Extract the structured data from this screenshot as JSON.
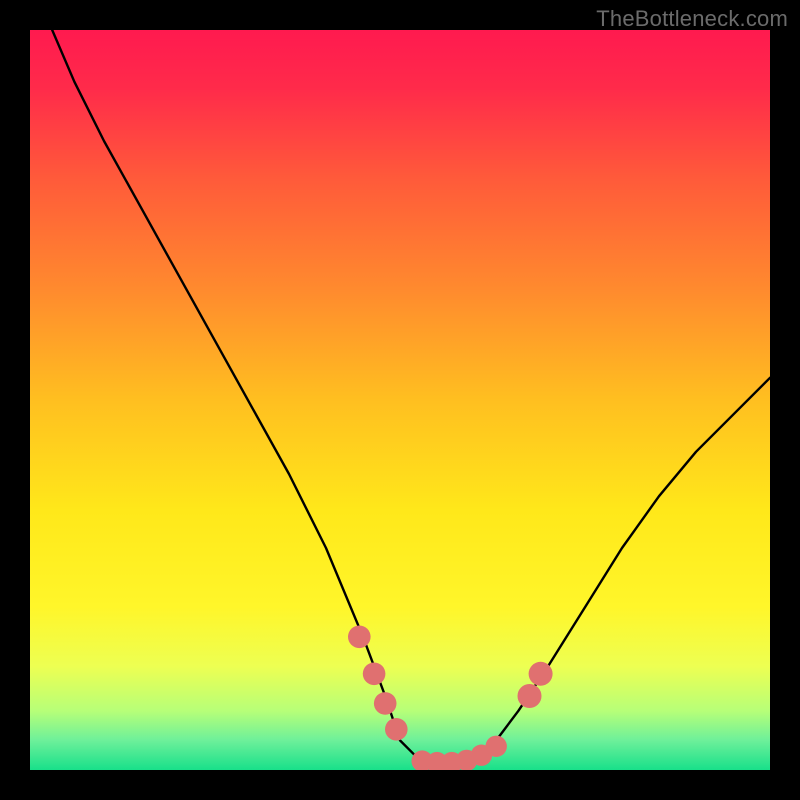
{
  "watermark": "TheBottleneck.com",
  "colors": {
    "background": "#000000",
    "gradient_stops": [
      {
        "offset": 0.0,
        "color": "#ff1a4f"
      },
      {
        "offset": 0.08,
        "color": "#ff2b4a"
      },
      {
        "offset": 0.2,
        "color": "#ff5a3a"
      },
      {
        "offset": 0.35,
        "color": "#ff8a2e"
      },
      {
        "offset": 0.5,
        "color": "#ffbf20"
      },
      {
        "offset": 0.65,
        "color": "#ffe81a"
      },
      {
        "offset": 0.78,
        "color": "#fff62a"
      },
      {
        "offset": 0.86,
        "color": "#edff52"
      },
      {
        "offset": 0.92,
        "color": "#b7ff78"
      },
      {
        "offset": 0.96,
        "color": "#6df09a"
      },
      {
        "offset": 1.0,
        "color": "#18e08a"
      }
    ],
    "curve": "#000000",
    "markers": "#e07070"
  },
  "chart_data": {
    "type": "line",
    "title": "",
    "xlabel": "",
    "ylabel": "",
    "xlim": [
      0,
      100
    ],
    "ylim": [
      0,
      100
    ],
    "grid": false,
    "series": [
      {
        "name": "curve",
        "x": [
          3,
          6,
          10,
          15,
          20,
          25,
          30,
          35,
          40,
          45,
          48,
          50,
          52,
          55,
          58,
          60,
          63,
          66,
          70,
          75,
          80,
          85,
          90,
          95,
          100
        ],
        "y": [
          100,
          93,
          85,
          76,
          67,
          58,
          49,
          40,
          30,
          18,
          10,
          4,
          2,
          1,
          1,
          2,
          4,
          8,
          14,
          22,
          30,
          37,
          43,
          48,
          53
        ]
      }
    ],
    "markers": [
      {
        "x": 44.5,
        "y": 18,
        "r": 1.1
      },
      {
        "x": 46.5,
        "y": 13,
        "r": 1.1
      },
      {
        "x": 48.0,
        "y": 9,
        "r": 1.1
      },
      {
        "x": 49.5,
        "y": 5.5,
        "r": 1.1
      },
      {
        "x": 53.0,
        "y": 1.2,
        "r": 1.0
      },
      {
        "x": 55.0,
        "y": 1.0,
        "r": 1.0
      },
      {
        "x": 57.0,
        "y": 1.0,
        "r": 1.0
      },
      {
        "x": 59.0,
        "y": 1.3,
        "r": 1.0
      },
      {
        "x": 61.0,
        "y": 2.0,
        "r": 1.0
      },
      {
        "x": 63.0,
        "y": 3.2,
        "r": 1.0
      },
      {
        "x": 67.5,
        "y": 10,
        "r": 1.2
      },
      {
        "x": 69.0,
        "y": 13,
        "r": 1.2
      }
    ]
  }
}
